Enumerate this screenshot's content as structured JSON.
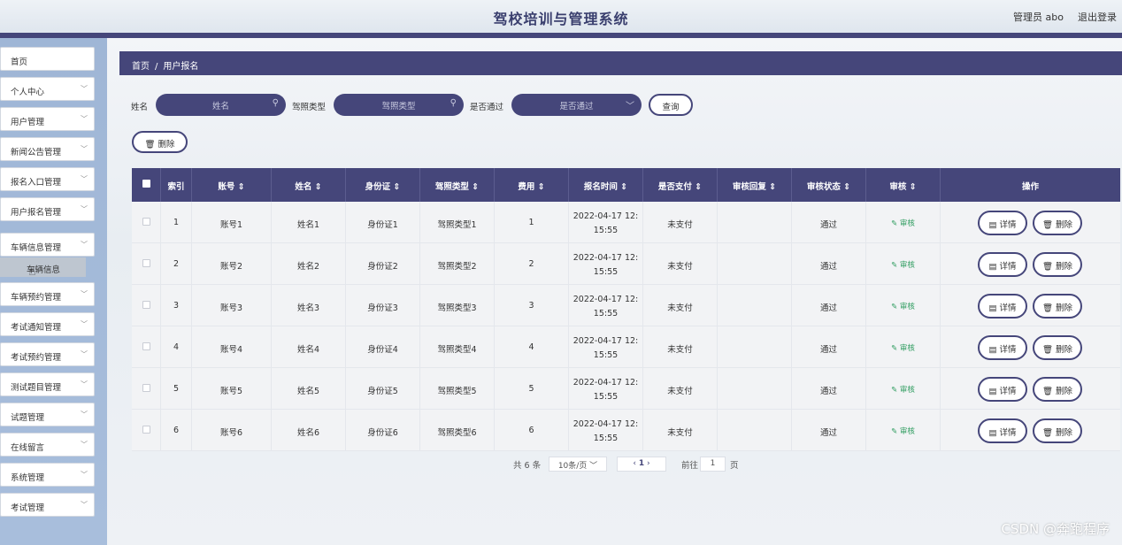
{
  "header": {
    "title": "驾校培训与管理系统",
    "user": "管理员 abo",
    "logout": "退出登录"
  },
  "sidebar": {
    "items": [
      {
        "label": "首页",
        "has_chevron": false
      },
      {
        "label": "个人中心",
        "has_chevron": true
      },
      {
        "label": "用户管理",
        "has_chevron": true
      },
      {
        "label": "新闻公告管理",
        "has_chevron": true
      },
      {
        "label": "报名入口管理",
        "has_chevron": true
      },
      {
        "label": "用户报名管理",
        "has_chevron": true
      },
      {
        "label": "车辆信息管理",
        "has_chevron": true
      },
      {
        "label": "车辆预约管理",
        "has_chevron": true
      },
      {
        "label": "考试通知管理",
        "has_chevron": true
      },
      {
        "label": "考试预约管理",
        "has_chevron": true
      },
      {
        "label": "测试题目管理",
        "has_chevron": true
      },
      {
        "label": "试题管理",
        "has_chevron": true
      },
      {
        "label": "在线留言",
        "has_chevron": true
      },
      {
        "label": "系统管理",
        "has_chevron": true
      },
      {
        "label": "考试管理",
        "has_chevron": true
      }
    ],
    "sub_item": "车辆信息"
  },
  "breadcrumb": {
    "home": "首页",
    "separator": "/",
    "current": "用户报名"
  },
  "search": {
    "name_label": "姓名",
    "name_placeholder": "姓名",
    "license_label": "驾照类型",
    "license_placeholder": "驾照类型",
    "pass_label": "是否通过",
    "pass_placeholder": "是否通过",
    "query_button": "查询",
    "delete_button": "删除"
  },
  "table": {
    "columns": [
      "索引",
      "账号",
      "姓名",
      "身份证",
      "驾照类型",
      "费用",
      "报名时间",
      "是否支付",
      "审核回复",
      "审核状态",
      "审核",
      "操作"
    ],
    "rows": [
      {
        "index": "1",
        "account": "账号1",
        "name": "姓名1",
        "id_card": "身份证1",
        "license": "驾照类型1",
        "fee": "1",
        "time_1": "2022-04-17 12:",
        "time_2": "15:55",
        "paid": "未支付",
        "reply": "",
        "status": "通过",
        "audit": "审核"
      },
      {
        "index": "2",
        "account": "账号2",
        "name": "姓名2",
        "id_card": "身份证2",
        "license": "驾照类型2",
        "fee": "2",
        "time_1": "2022-04-17 12:",
        "time_2": "15:55",
        "paid": "未支付",
        "reply": "",
        "status": "通过",
        "audit": "审核"
      },
      {
        "index": "3",
        "account": "账号3",
        "name": "姓名3",
        "id_card": "身份证3",
        "license": "驾照类型3",
        "fee": "3",
        "time_1": "2022-04-17 12:",
        "time_2": "15:55",
        "paid": "未支付",
        "reply": "",
        "status": "通过",
        "audit": "审核"
      },
      {
        "index": "4",
        "account": "账号4",
        "name": "姓名4",
        "id_card": "身份证4",
        "license": "驾照类型4",
        "fee": "4",
        "time_1": "2022-04-17 12:",
        "time_2": "15:55",
        "paid": "未支付",
        "reply": "",
        "status": "通过",
        "audit": "审核"
      },
      {
        "index": "5",
        "account": "账号5",
        "name": "姓名5",
        "id_card": "身份证5",
        "license": "驾照类型5",
        "fee": "5",
        "time_1": "2022-04-17 12:",
        "time_2": "15:55",
        "paid": "未支付",
        "reply": "",
        "status": "通过",
        "audit": "审核"
      },
      {
        "index": "6",
        "account": "账号6",
        "name": "姓名6",
        "id_card": "身份证6",
        "license": "驾照类型6",
        "fee": "6",
        "time_1": "2022-04-17 12:",
        "time_2": "15:55",
        "paid": "未支付",
        "reply": "",
        "status": "通过",
        "audit": "审核"
      }
    ],
    "detail_button": "详情",
    "delete_button": "删除"
  },
  "pagination": {
    "total": "共 6 条",
    "page_size": "10条/页",
    "current_page": "1",
    "goto_label": "前往",
    "goto_value": "1",
    "page_suffix": "页"
  },
  "watermark": "CSDN @奔跑程序",
  "colors": {
    "primary": "#45467a",
    "audit_green": "#2e9c5f"
  }
}
